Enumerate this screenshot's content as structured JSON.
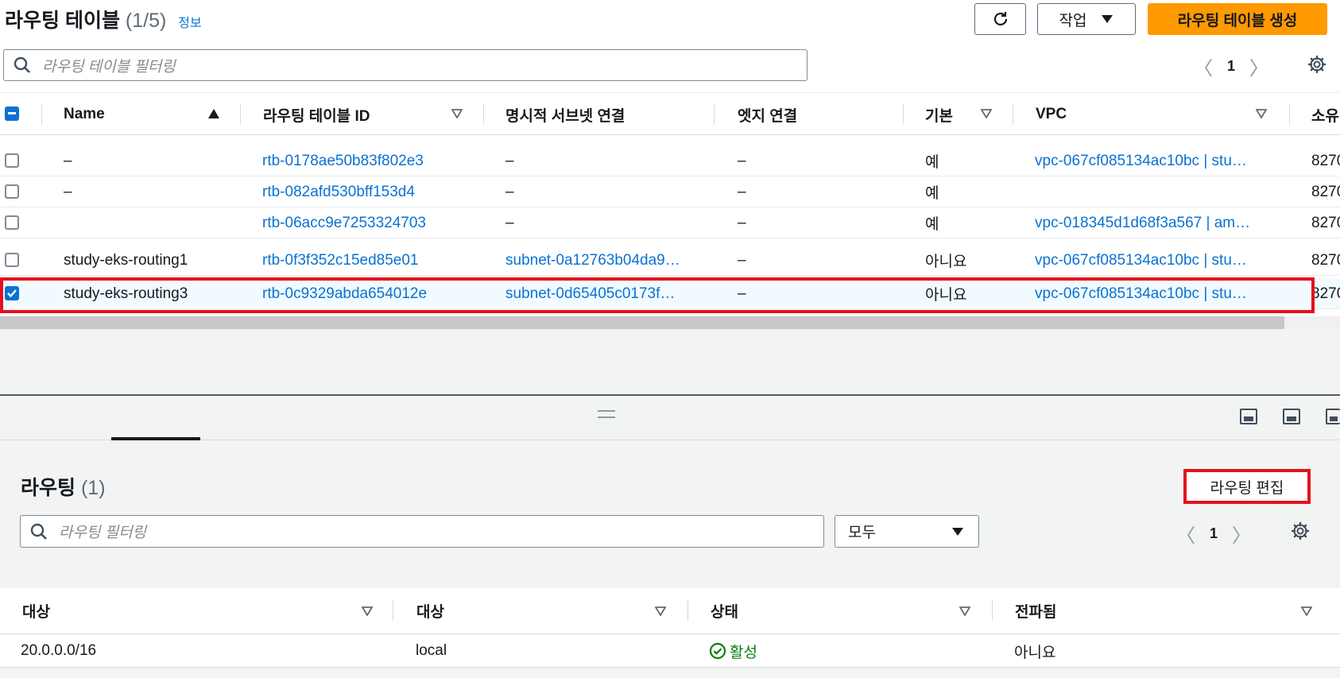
{
  "header": {
    "title": "라우팅 테이블",
    "count": "(1/5)",
    "info_link": "정보",
    "refresh_icon": "refresh-icon",
    "actions_label": "작업",
    "create_label": "라우팅 테이블 생성"
  },
  "search": {
    "placeholder": "라우팅 테이블 필터링"
  },
  "pagination": {
    "page": "1"
  },
  "table": {
    "columns": [
      "Name",
      "라우팅 테이블 ID",
      "명시적 서브넷 연결",
      "엣지 연결",
      "기본",
      "VPC",
      "소유"
    ],
    "rows": [
      {
        "selected": false,
        "name": "–",
        "id": "rtb-0178ae50b83f802e3",
        "subnet": "–",
        "edge": "–",
        "main": "예",
        "vpc": "vpc-067cf085134ac10bc | stu…",
        "owner": "8270"
      },
      {
        "selected": false,
        "name": "–",
        "id": "rtb-082afd530bff153d4",
        "subnet": "–",
        "edge": "–",
        "main": "예",
        "vpc": "",
        "owner": "8270"
      },
      {
        "selected": false,
        "name": "",
        "id": "rtb-06acc9e7253324703",
        "subnet": "–",
        "edge": "–",
        "main": "예",
        "vpc": "vpc-018345d1d68f3a567 | am…",
        "owner": "8270"
      },
      {
        "selected": false,
        "name": "study-eks-routing1",
        "id": "rtb-0f3f352c15ed85e01",
        "subnet": "subnet-0a12763b04da9…",
        "edge": "–",
        "main": "아니요",
        "vpc": "vpc-067cf085134ac10bc | stu…",
        "owner": "8270"
      },
      {
        "selected": true,
        "name": "study-eks-routing3",
        "id": "rtb-0c9329abda654012e",
        "subnet": "subnet-0d65405c0173f…",
        "edge": "–",
        "main": "아니요",
        "vpc": "vpc-067cf085134ac10bc | stu…",
        "owner": "8270"
      }
    ]
  },
  "routes": {
    "title": "라우팅",
    "count": "(1)",
    "edit_label": "라우팅 편집",
    "search_placeholder": "라우팅 필터링",
    "filter_value": "모두",
    "page": "1",
    "columns": [
      "대상",
      "대상",
      "상태",
      "전파됨"
    ],
    "rows": [
      {
        "destination": "20.0.0.0/16",
        "target": "local",
        "status": "활성",
        "propagated": "아니요"
      }
    ]
  },
  "colors": {
    "primary": "#ff9900",
    "link": "#0972d3",
    "highlight": "#e3121b",
    "success": "#037f0c"
  }
}
